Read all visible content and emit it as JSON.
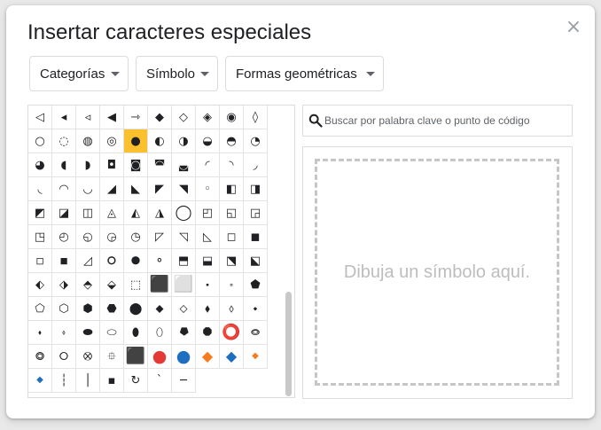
{
  "dialog": {
    "title": "Insertar caracteres especiales",
    "close_label": "×"
  },
  "filters": {
    "categories_label": "Categorías",
    "symbol_label": "Símbolo",
    "shapes_label": "Formas geométricas"
  },
  "search": {
    "placeholder": "Buscar por palabra clave o punto de código",
    "value": ""
  },
  "draw": {
    "hint": "Dibuja un símbolo aquí."
  },
  "grid": {
    "selected_index": 14,
    "symbols": [
      "◁",
      "◂",
      "◃",
      "◀",
      "⇾",
      "◆",
      "◇",
      "◈",
      "◉",
      "◊",
      "○",
      "◌",
      "◍",
      "◎",
      "●",
      "◐",
      "◑",
      "◒",
      "◓",
      "◔",
      "◕",
      "◖",
      "◗",
      "◘",
      "◙",
      "◚",
      "◛",
      "◜",
      "◝",
      "◞",
      "◟",
      "◠",
      "◡",
      "◢",
      "◣",
      "◤",
      "◥",
      "◦",
      "◧",
      "◨",
      "◩",
      "◪",
      "◫",
      "◬",
      "◭",
      "◮",
      "◯",
      "◰",
      "◱",
      "◲",
      "◳",
      "◴",
      "◵",
      "◶",
      "◷",
      "◸",
      "◹",
      "◺",
      "◻",
      "◼",
      "◽",
      "◾",
      "◿",
      "⚪",
      "⚫",
      "⚬",
      "⬒",
      "⬓",
      "⬔",
      "⬕",
      "⬖",
      "⬗",
      "⬘",
      "⬙",
      "⬚",
      "⬛",
      "⬜",
      "⬝",
      "⬞",
      "⬟",
      "⬠",
      "⬡",
      "⬢",
      "⬣",
      "⬤",
      "⬥",
      "⬦",
      "⬧",
      "⬨",
      "⬩",
      "⬪",
      "⬫",
      "⬬",
      "⬭",
      "⬮",
      "⬯",
      "⯂",
      "⯃",
      "⭕",
      "⭖",
      "⭗",
      "⭘",
      "⭙",
      "⯐",
      "⬛",
      "🔴",
      "🔵",
      "🔶",
      "🔷",
      "🔸",
      "🔹",
      "┆",
      "│",
      "▪",
      "↻",
      "`",
      "─"
    ]
  },
  "colors": {
    "selected": "#fbc02d",
    "red": "#e53935",
    "blue": "#1e6fbf",
    "orange": "#f57c1f"
  }
}
